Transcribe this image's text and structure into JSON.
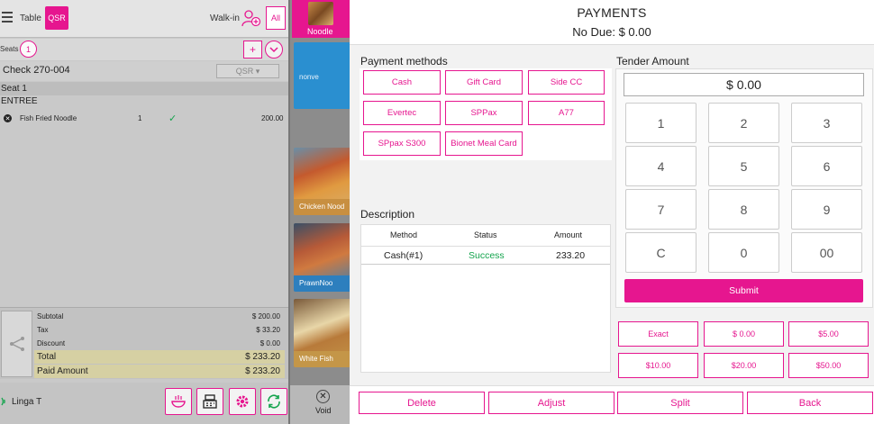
{
  "pos": {
    "table_label": "Table",
    "qsr_label": "QSR",
    "walkin_label": "Walk-in",
    "all_label": "All",
    "seats_label": "Seats",
    "seat_count": "1",
    "plus_label": "+",
    "check_label": "Check 270-004",
    "qsr_select": "QSR ▾",
    "seat_heading": "Seat 1",
    "course": "ENTREE",
    "item": {
      "name": "Fish Fried Noodle",
      "qty": "1",
      "price": "200.00"
    },
    "totals": {
      "subtotal_label": "Subtotal",
      "subtotal": "$ 200.00",
      "tax_label": "Tax",
      "tax": "$ 33.20",
      "discount_label": "Discount",
      "discount": "$ 0.00",
      "total_label": "Total",
      "total": "$ 233.20",
      "paid_label": "Paid Amount",
      "paid": "$ 233.20"
    },
    "linga_label": "Linga T"
  },
  "menu": {
    "tab_label": "Noodle",
    "cards": [
      {
        "label": "nonve",
        "color": "#2a8fd0"
      },
      {
        "label": "Chicken Nood",
        "color": "#c88f40"
      },
      {
        "label": "PrawnNoo",
        "color": "#2d7fbe"
      },
      {
        "label": "White Fish",
        "color": "#c49648"
      }
    ],
    "void_label": "Void"
  },
  "payments": {
    "title": "PAYMENTS",
    "due": "No Due: $ 0.00",
    "methods_label": "Payment methods",
    "methods": [
      "Cash",
      "Gift Card",
      "Side CC",
      "Evertec",
      "SPPax",
      "A77",
      "SPpax S300",
      "Bionet Meal Card"
    ],
    "description_label": "Description",
    "columns": [
      "Method",
      "Status",
      "Amount"
    ],
    "rows": [
      {
        "method": "Cash(#1)",
        "status": "Success",
        "amount": "233.20"
      }
    ],
    "tender_label": "Tender Amount",
    "tender_value": "$ 0.00",
    "keys": [
      "1",
      "2",
      "3",
      "4",
      "5",
      "6",
      "7",
      "8",
      "9",
      "C",
      "0",
      "00"
    ],
    "submit_label": "Submit",
    "quick": [
      "Exact",
      "$ 0.00",
      "$5.00",
      "$10.00",
      "$20.00",
      "$50.00"
    ],
    "footer": [
      "Delete",
      "Adjust",
      "Split",
      "Back"
    ]
  },
  "colors": {
    "accent": "#e6168f",
    "success": "#14a44d"
  }
}
